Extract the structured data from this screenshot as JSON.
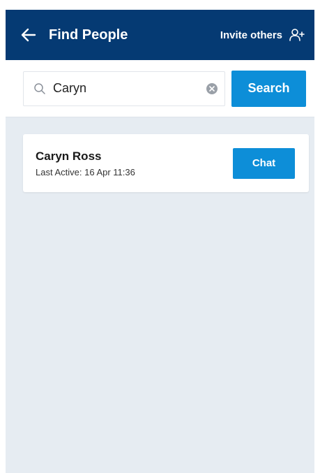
{
  "header": {
    "title": "Find People",
    "invite_label": "Invite others",
    "back_icon": "arrow-left-icon",
    "invite_icon": "person-add-icon"
  },
  "search": {
    "value": "Caryn",
    "placeholder": "",
    "button_label": "Search"
  },
  "results": [
    {
      "name": "Caryn Ross",
      "last_active": "Last Active: 16 Apr 11:36",
      "action_label": "Chat"
    }
  ],
  "colors": {
    "header_bg": "#053a73",
    "accent": "#0d8ed8",
    "page_bg": "#e6ecf2"
  }
}
